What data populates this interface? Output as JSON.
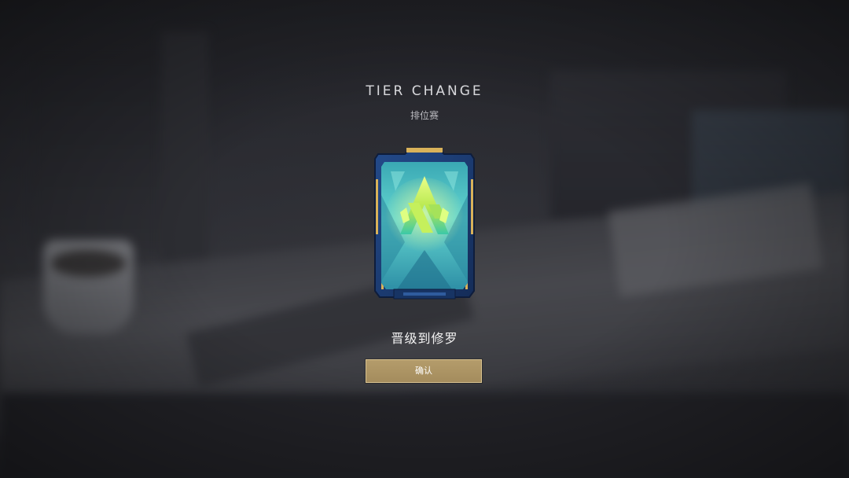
{
  "dialog": {
    "title": "TIER CHANGE",
    "subtitle": "排位赛",
    "result_text": "晋级到修罗",
    "confirm_label": "确认"
  },
  "emblem": {
    "icon": "tier-emblem-icon",
    "frame_color": "#1f3f78",
    "gold_color": "#d9b25a",
    "teal_color": "#5fd8d0",
    "glow_color": "#c9f05a"
  },
  "colors": {
    "button_fill": "#ab9462",
    "button_border": "#d8c290",
    "title_text": "#d8d8dc"
  }
}
